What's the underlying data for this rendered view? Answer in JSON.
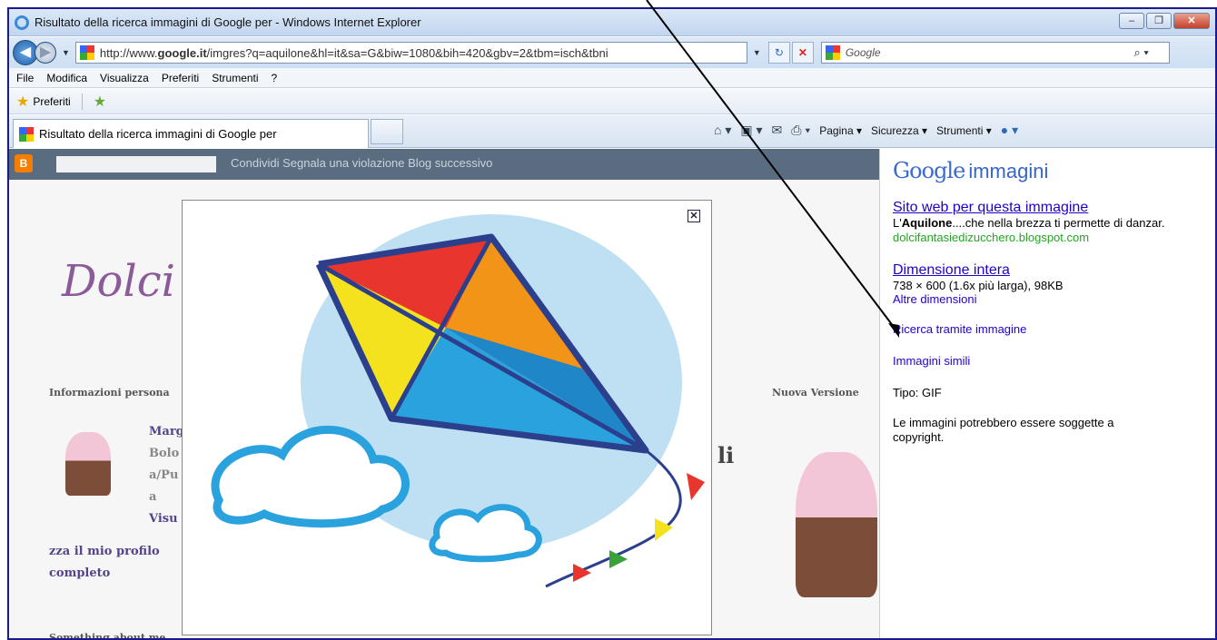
{
  "window": {
    "title": "Risultato della ricerca immagini di Google per - Windows Internet Explorer",
    "min": "–",
    "max": "❐",
    "close": "✕"
  },
  "address": {
    "prefix": "http://www.",
    "domain": "google.it",
    "rest": "/imgres?q=aquilone&hl=it&sa=G&biw=1080&bih=420&gbv=2&tbm=isch&tbni",
    "search_placeholder": "Google"
  },
  "menu": [
    "File",
    "Modifica",
    "Visualizza",
    "Preferiti",
    "Strumenti",
    "?"
  ],
  "favorites": {
    "label": "Preferiti"
  },
  "tab": {
    "title": "Risultato della ricerca immagini di Google per"
  },
  "cmd": {
    "pagina": "Pagina ▾",
    "sicurezza": "Sicurezza ▾",
    "strumenti": "Strumenti ▾"
  },
  "blog": {
    "links": "Condividi   Segnala una violazione   Blog successivo",
    "title": "Dolci",
    "info_head": "Informazioni persona",
    "profile": [
      "Marg",
      "Bolo",
      "a/Pu",
      "a",
      "Visu"
    ],
    "profile_link": [
      "zza il mio profilo",
      "completo"
    ],
    "new_version": "Nuova Versione",
    "something": "Something about me...",
    "li": "li"
  },
  "panel": {
    "logo_google": "Google",
    "logo_suffix": "immagini",
    "site_link": "Sito web per questa immagine",
    "desc_bold": "Aquilone",
    "desc_pre": "L'",
    "desc_post": "....che nella brezza ti permette di danzar.",
    "site_url": "dolcifantasiedizucchero.blogspot.com",
    "full_size": "Dimensione intera",
    "size_info": "738 × 600 (1.6x più larga), 98KB",
    "other_sizes": "Altre dimensioni",
    "search_by_image": "Ricerca tramite immagine",
    "similar": "Immagini simili",
    "type": "Tipo:  GIF",
    "copyright": "Le immagini potrebbero essere soggette a copyright."
  },
  "colors": {
    "link": "#2200cc",
    "green": "#22a622",
    "blogbar": "#5a6d80"
  }
}
